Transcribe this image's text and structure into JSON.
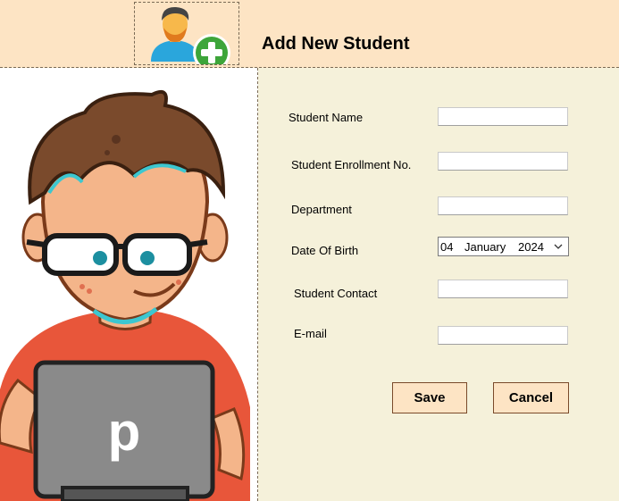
{
  "header": {
    "title": "Add New Student"
  },
  "form": {
    "student_name_label": "Student Name",
    "enrollment_label": "Student Enrollment No.",
    "department_label": "Department",
    "dob_label": "Date Of Birth",
    "contact_label": "Student Contact",
    "email_label": "E-mail",
    "dob": {
      "day": "04",
      "month": "January",
      "year": "2024"
    }
  },
  "buttons": {
    "save": "Save",
    "cancel": "Cancel"
  },
  "illustration": {
    "laptop_letter": "p"
  },
  "colors": {
    "header_bg": "#FDE4C4",
    "form_bg": "#F5F1DA",
    "button_bg": "#FDE4C4"
  },
  "icons": {
    "logo": "add-user-icon",
    "date_dropdown": "chevron-down-icon"
  }
}
